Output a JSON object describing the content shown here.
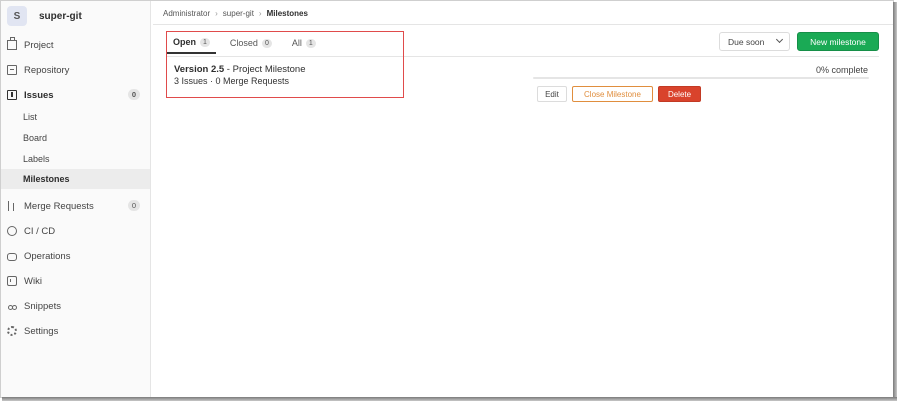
{
  "project": {
    "avatar_letter": "S",
    "name": "super-git"
  },
  "sidebar": {
    "items": [
      {
        "label": "Project",
        "icon": "project-icon"
      },
      {
        "label": "Repository",
        "icon": "repository-icon"
      },
      {
        "label": "Issues",
        "icon": "issues-icon",
        "count": "0"
      },
      {
        "label": "Merge Requests",
        "icon": "merge-request-icon",
        "count": "0"
      },
      {
        "label": "CI / CD",
        "icon": "cicd-icon"
      },
      {
        "label": "Operations",
        "icon": "operations-icon"
      },
      {
        "label": "Wiki",
        "icon": "wiki-icon"
      },
      {
        "label": "Snippets",
        "icon": "snippets-icon"
      },
      {
        "label": "Settings",
        "icon": "settings-icon"
      }
    ],
    "issues_sub": [
      "List",
      "Board",
      "Labels",
      "Milestones"
    ]
  },
  "breadcrumb": [
    "Administrator",
    "super-git",
    "Milestones"
  ],
  "tabs": [
    {
      "label": "Open",
      "count": "1"
    },
    {
      "label": "Closed",
      "count": "0"
    },
    {
      "label": "All",
      "count": "1"
    }
  ],
  "sort": {
    "label": "Due soon"
  },
  "new_milestone_label": "New milestone",
  "milestone": {
    "title": "Version 2.5",
    "kind": " - Project Milestone",
    "meta": "3 Issues · 0 Merge Requests",
    "progress_label": "0% complete",
    "progress_fraction": 0
  },
  "actions": {
    "edit": "Edit",
    "close": "Close Milestone",
    "delete": "Delete"
  },
  "colors": {
    "accent_green": "#1aaa55",
    "danger_red": "#d9432c",
    "warning_orange": "#e08e3e",
    "highlight_red": "#e04b4b"
  }
}
